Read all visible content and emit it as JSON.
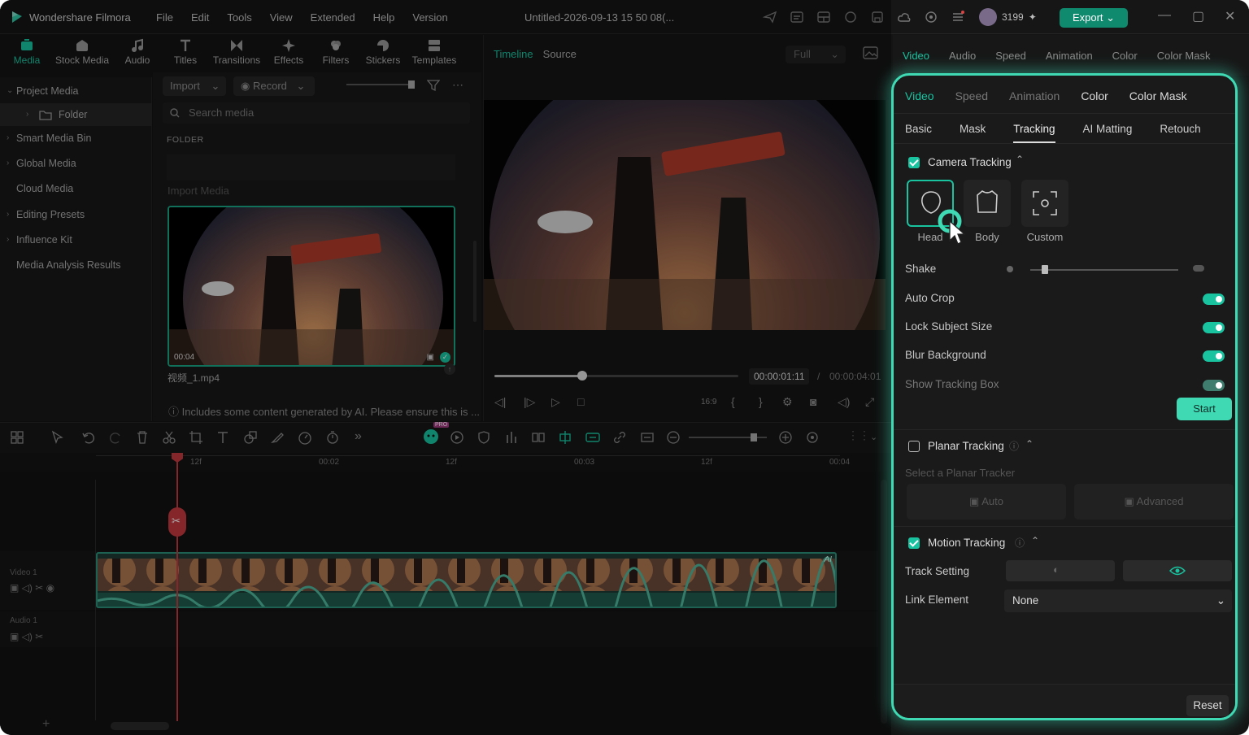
{
  "app": {
    "name": "Wondershare Filmora",
    "document_title": "Untitled-2026-09-13 15 50 08(...",
    "credits": "3199",
    "export_label": "Export"
  },
  "menu": [
    "File",
    "Edit",
    "Tools",
    "View",
    "Extended",
    "Help",
    "Version"
  ],
  "toolbar": [
    {
      "label": "Media",
      "icon": "media-icon",
      "active": true
    },
    {
      "label": "Stock Media",
      "icon": "stock-media-icon"
    },
    {
      "label": "Audio",
      "icon": "music-note-icon"
    },
    {
      "label": "Titles",
      "icon": "text-icon"
    },
    {
      "label": "Transitions",
      "icon": "transition-icon"
    },
    {
      "label": "Effects",
      "icon": "effects-icon"
    },
    {
      "label": "Filters",
      "icon": "filters-icon"
    },
    {
      "label": "Stickers",
      "icon": "sticker-icon"
    },
    {
      "label": "Templates",
      "icon": "templates-icon"
    }
  ],
  "sidebar": {
    "items": [
      {
        "label": "Project Media"
      },
      {
        "label": "Folder"
      },
      {
        "label": "Smart Media Bin"
      },
      {
        "label": "Global Media"
      },
      {
        "label": "Cloud Media"
      },
      {
        "label": "Editing Presets"
      },
      {
        "label": "Influence Kit"
      },
      {
        "label": "Media Analysis Results"
      }
    ]
  },
  "media": {
    "import_label": "Import",
    "record_label": "Record",
    "search_placeholder": "Search media",
    "folder_header": "FOLDER",
    "import_media_label": "Import Media",
    "clip_duration": "00:04",
    "clip_name": "视频_1.mp4",
    "ai_notice": "Includes some content generated by AI. Please ensure this is ..."
  },
  "preview": {
    "tab_timeline": "Timeline",
    "tab_source": "Source",
    "zoom": "Full",
    "current_time": "00:00:01:11",
    "separator": "/",
    "total_time": "00:00:04:01",
    "ratio": "16:9",
    "progress": 0.36
  },
  "right_tabs": [
    "Video",
    "Audio",
    "Speed",
    "Animation",
    "Color",
    "Color Mask"
  ],
  "inspector": {
    "tabs": [
      "Video",
      "Speed",
      "Animation",
      "Color",
      "Color Mask"
    ],
    "subtabs": [
      "Basic",
      "Mask",
      "Tracking",
      "AI Matting",
      "Retouch"
    ],
    "camera_tracking": {
      "title": "Camera Tracking",
      "modes": [
        "Head",
        "Body",
        "Custom"
      ],
      "shake_label": "Shake",
      "auto_crop": "Auto Crop",
      "lock_subject": "Lock Subject Size",
      "blur_bg": "Blur Background",
      "show_box": "Show Tracking Box",
      "start_label": "Start",
      "shake_value": 0.1
    },
    "planar_tracking": {
      "title": "Planar Tracking",
      "select_label": "Select a Planar Tracker",
      "auto_label": "Auto",
      "advanced_label": "Advanced"
    },
    "motion_tracking": {
      "title": "Motion Tracking",
      "track_setting": "Track Setting",
      "link_element": "Link Element",
      "link_value": "None"
    },
    "reset_label": "Reset"
  },
  "timeline": {
    "ruler": [
      "12f",
      "00:02",
      "12f",
      "00:03",
      "12f",
      "00:04"
    ],
    "video_track": "Video 1",
    "audio_track": "Audio 1",
    "ai_badge": "AI"
  },
  "colors": {
    "accent": "#19c3a0",
    "highlight": "#3fd9b4",
    "playhead": "#c5393f",
    "export": "#0f8a6e"
  }
}
